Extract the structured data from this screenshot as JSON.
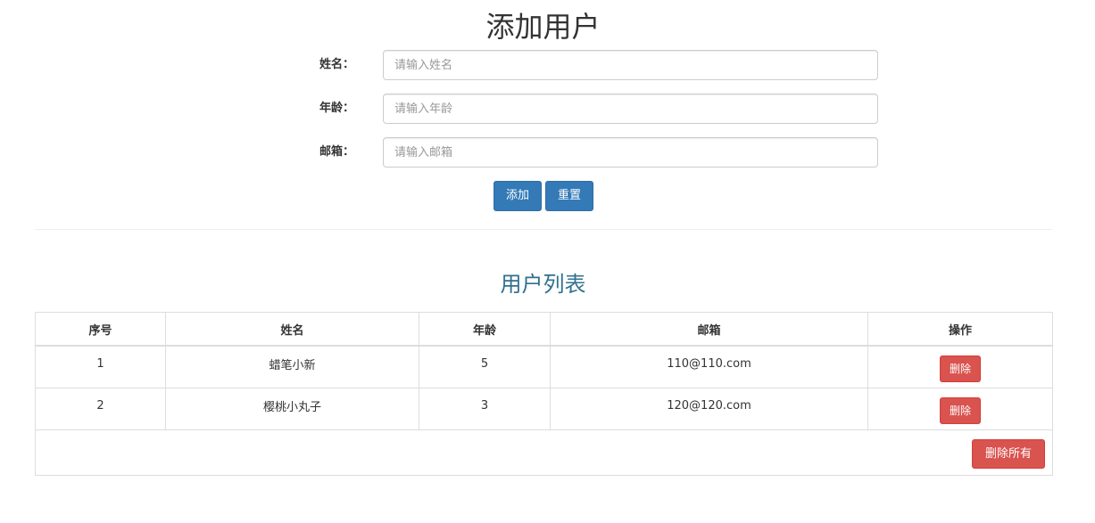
{
  "form": {
    "title": "添加用户",
    "fields": [
      {
        "label": "姓名：",
        "placeholder": "请输入姓名",
        "value": ""
      },
      {
        "label": "年龄：",
        "placeholder": "请输入年龄",
        "value": ""
      },
      {
        "label": "邮箱：",
        "placeholder": "请输入邮箱",
        "value": ""
      }
    ],
    "add_label": "添加",
    "reset_label": "重置"
  },
  "list": {
    "title": "用户列表",
    "columns": [
      "序号",
      "姓名",
      "年龄",
      "邮箱",
      "操作"
    ],
    "rows": [
      {
        "index": "1",
        "name": "蜡笔小新",
        "age": "5",
        "email": "110@110.com",
        "delete_label": "删除"
      },
      {
        "index": "2",
        "name": "樱桃小丸子",
        "age": "3",
        "email": "120@120.com",
        "delete_label": "删除"
      }
    ],
    "delete_all_label": "删除所有"
  },
  "colors": {
    "primary": "#337ab7",
    "danger": "#d9534f",
    "list_title": "#31708f"
  }
}
